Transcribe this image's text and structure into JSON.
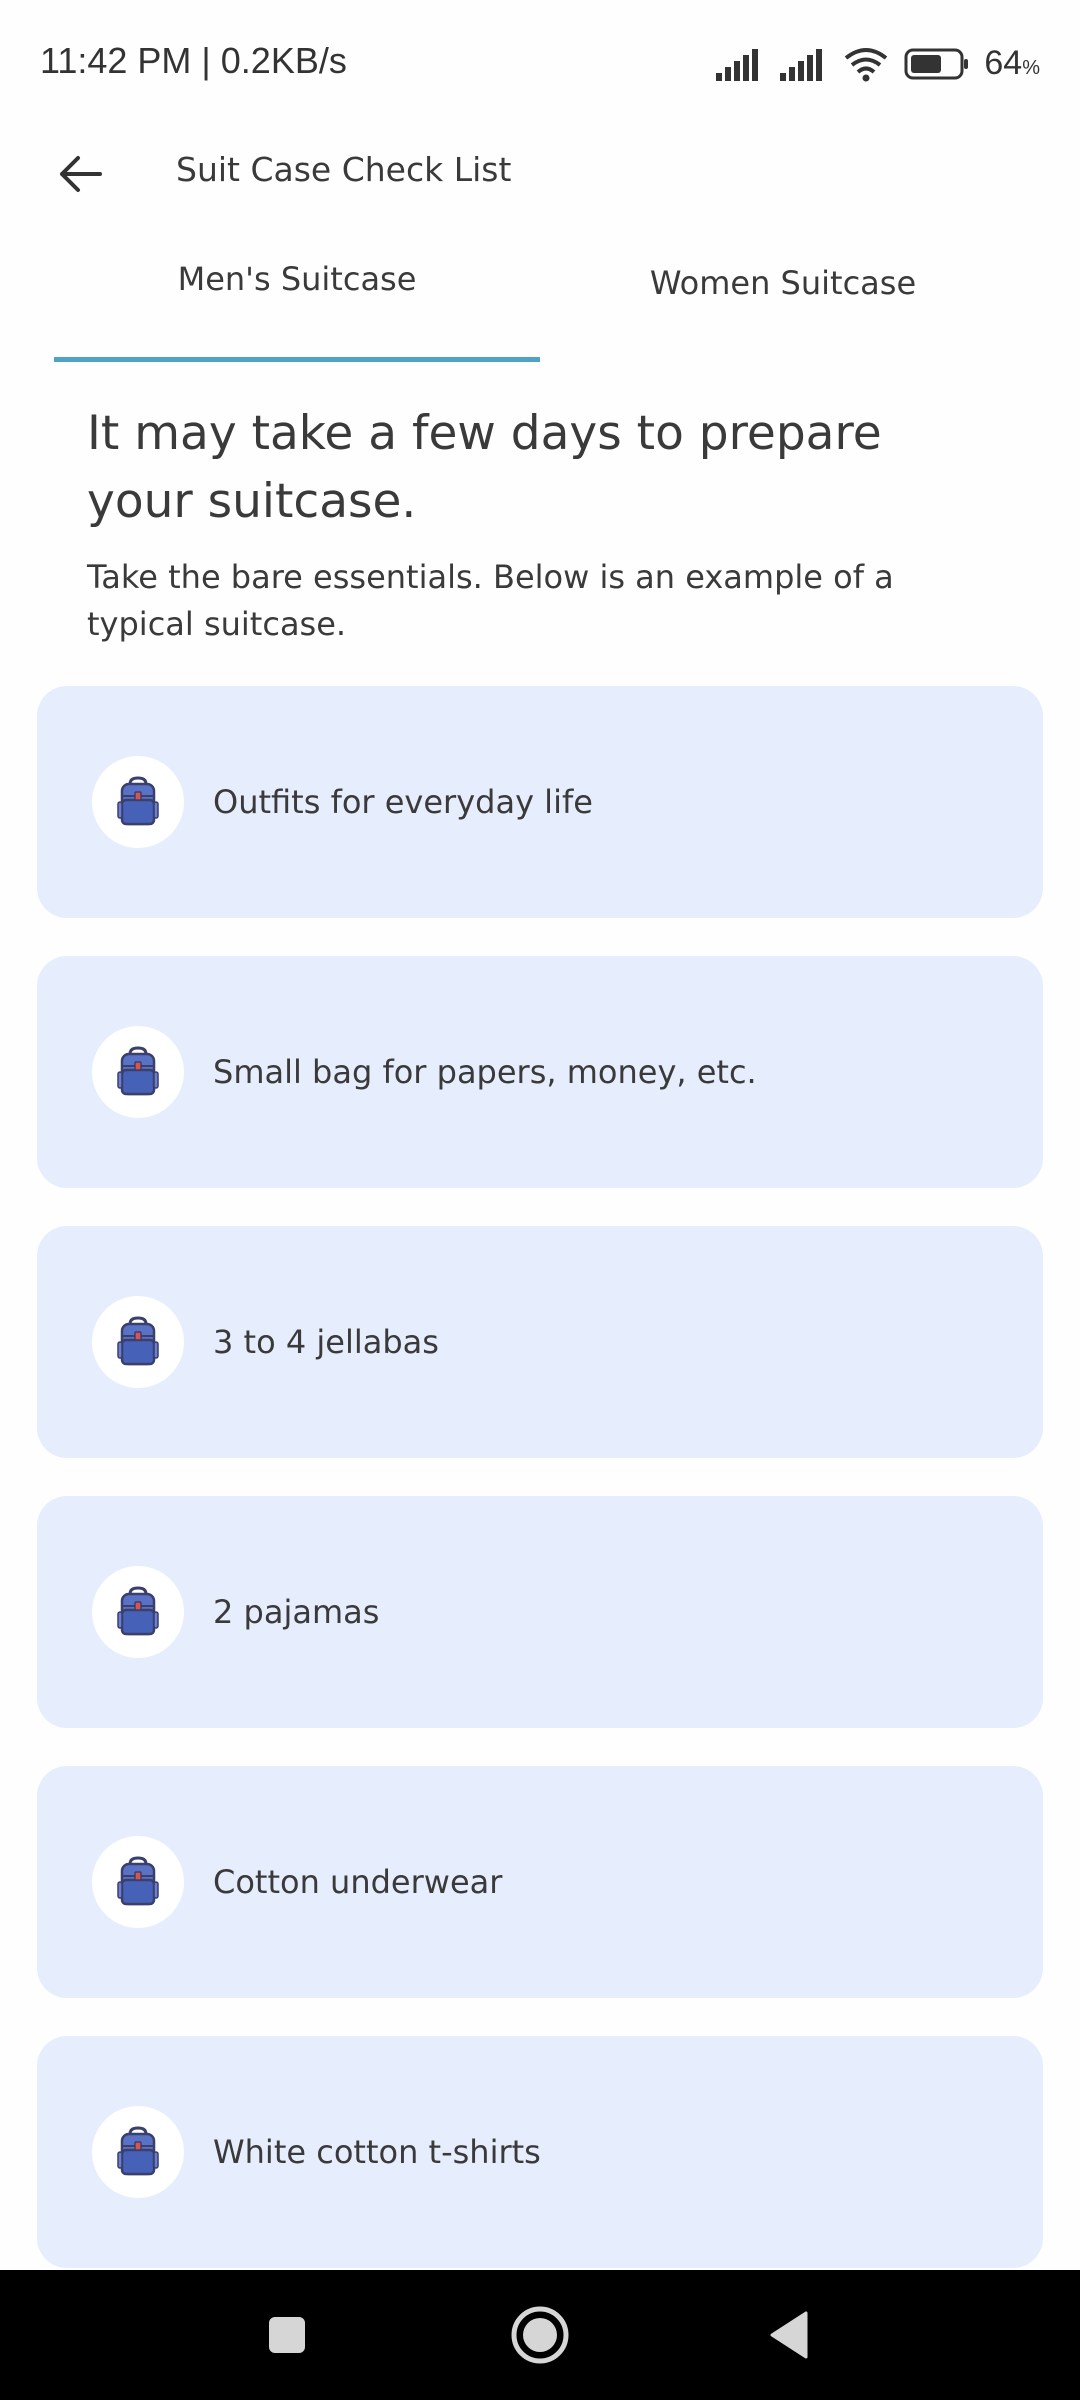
{
  "status_bar": {
    "time": "11:42 PM | 0.2KB/s",
    "battery": "64",
    "battery_unit": "%"
  },
  "app_bar": {
    "title": "Suit Case Check List"
  },
  "tabs": [
    {
      "label": "Men's Suitcase",
      "selected": true
    },
    {
      "label": "Women Suitcase",
      "selected": false
    }
  ],
  "intro": {
    "heading": "It may take a few days to prepare your suitcase.",
    "subtitle": "Take the bare essentials. Below is an example of a typical suitcase."
  },
  "items": [
    {
      "label": "Outfits for everyday life",
      "icon": "backpack-icon"
    },
    {
      "label": "Small bag for papers, money, etc.",
      "icon": "backpack-icon"
    },
    {
      "label": "3 to 4 jellabas",
      "icon": "backpack-icon"
    },
    {
      "label": "2 pajamas",
      "icon": "backpack-icon"
    },
    {
      "label": "Cotton underwear",
      "icon": "backpack-icon"
    },
    {
      "label": "White cotton t-shirts",
      "icon": "backpack-icon"
    }
  ],
  "colors": {
    "accent": "#4fa3c6",
    "card_bg": "#e6edfc"
  }
}
